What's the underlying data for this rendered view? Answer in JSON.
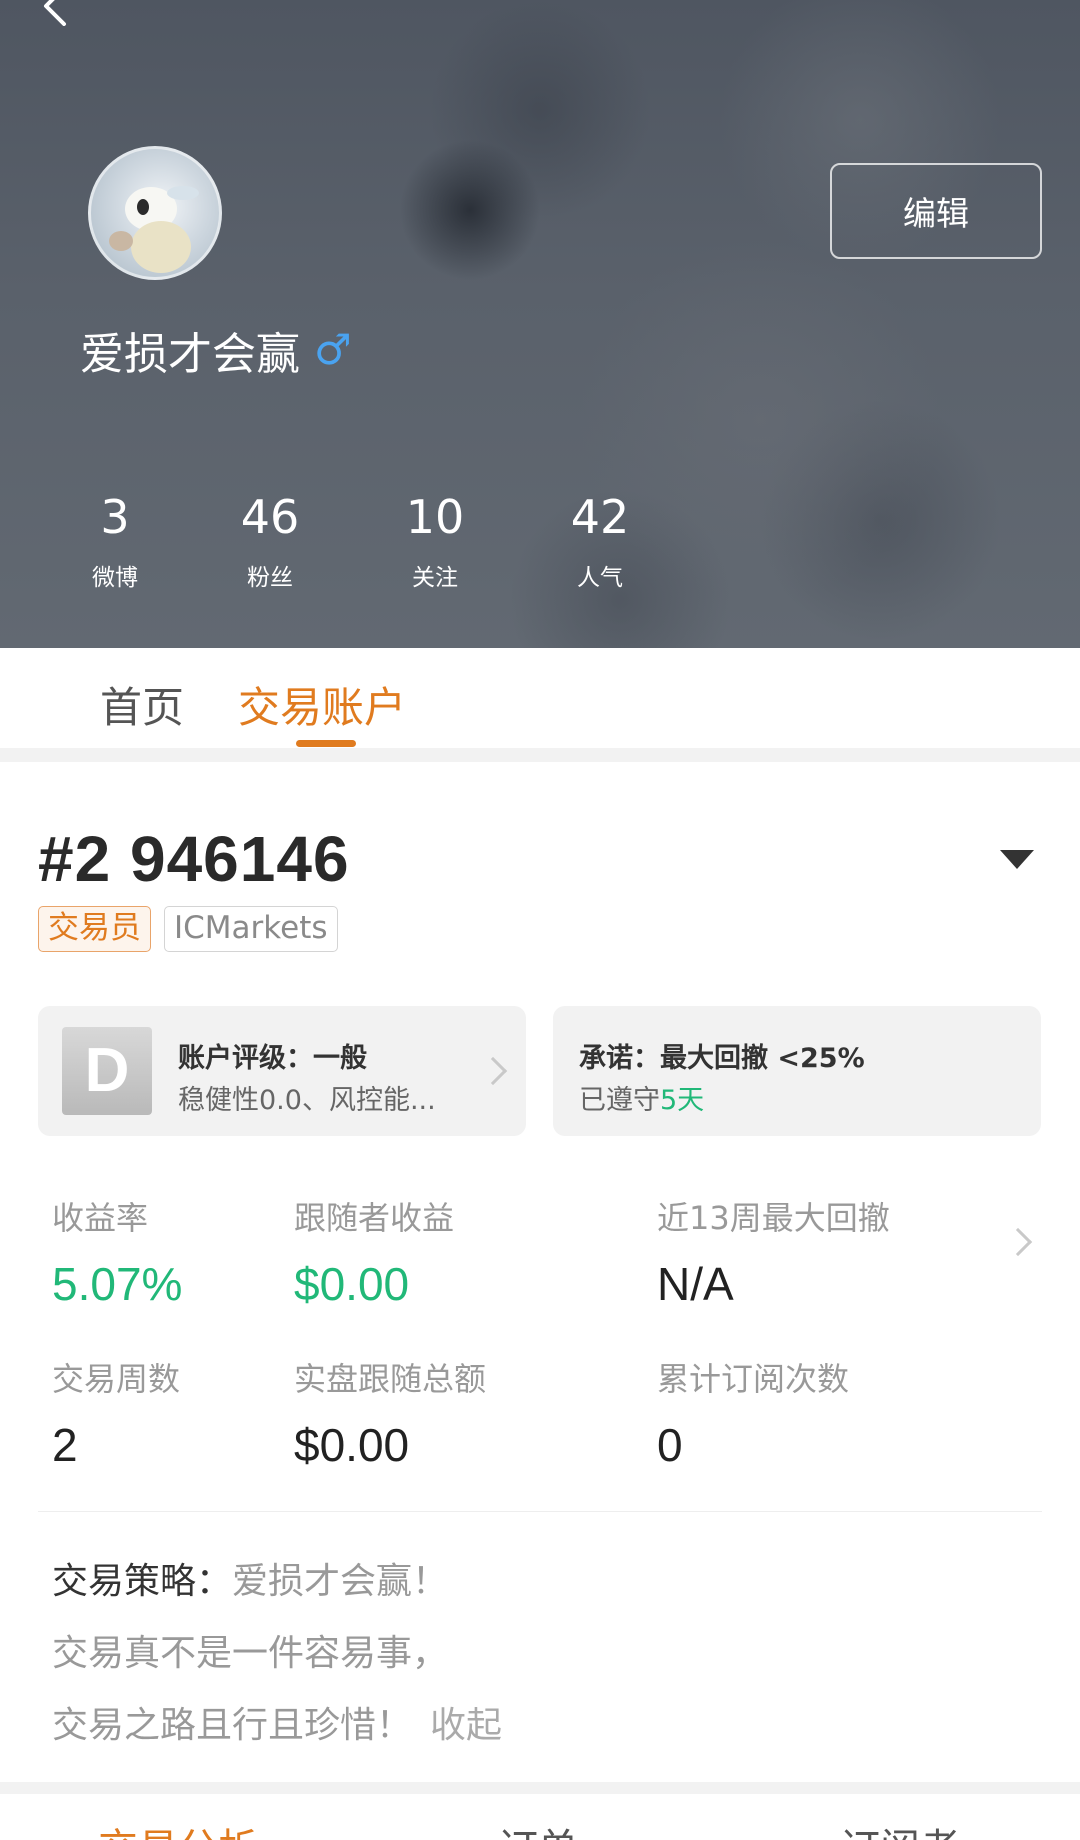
{
  "profile": {
    "username": "爱损才会赢",
    "gender_icon": "male-icon",
    "edit_label": "编辑",
    "stats": [
      {
        "value": "3",
        "label": "微博"
      },
      {
        "value": "46",
        "label": "粉丝"
      },
      {
        "value": "10",
        "label": "关注"
      },
      {
        "value": "42",
        "label": "人气"
      }
    ]
  },
  "tabs": [
    {
      "label": "首页",
      "active": false
    },
    {
      "label": "交易账户",
      "active": true
    }
  ],
  "account": {
    "id": "#2 946146",
    "tags": [
      "交易员",
      "ICMarkets"
    ],
    "rating_card": {
      "grade": "D",
      "title": "账户评级：一般",
      "subtitle": "稳健性0.0、风控能..."
    },
    "promise_card": {
      "title": "承诺：最大回撤 <25%",
      "subtitle_prefix": "已遵守",
      "subtitle_value": "5天"
    },
    "metrics": [
      {
        "label": "收益率",
        "value": "5.07%"
      },
      {
        "label": "跟随者收益",
        "value": "$0.00"
      },
      {
        "label": "近13周最大回撤",
        "value": "N/A"
      },
      {
        "label": "交易周数",
        "value": "2"
      },
      {
        "label": "实盘跟随总额",
        "value": "$0.00"
      },
      {
        "label": "累计订阅次数",
        "value": "0"
      }
    ]
  },
  "strategy": {
    "label": "交易策略：",
    "line1": "爱损才会赢！",
    "line2": "交易真不是一件容易事，",
    "line3": "交易之路且行且珍惜！",
    "collapse_label": "收起"
  },
  "bottom_tabs": [
    "交易分析",
    "订单",
    "订阅者"
  ],
  "colors": {
    "accent": "#e07b1f",
    "positive": "#21b878",
    "male_icon": "#4aa3f0"
  }
}
